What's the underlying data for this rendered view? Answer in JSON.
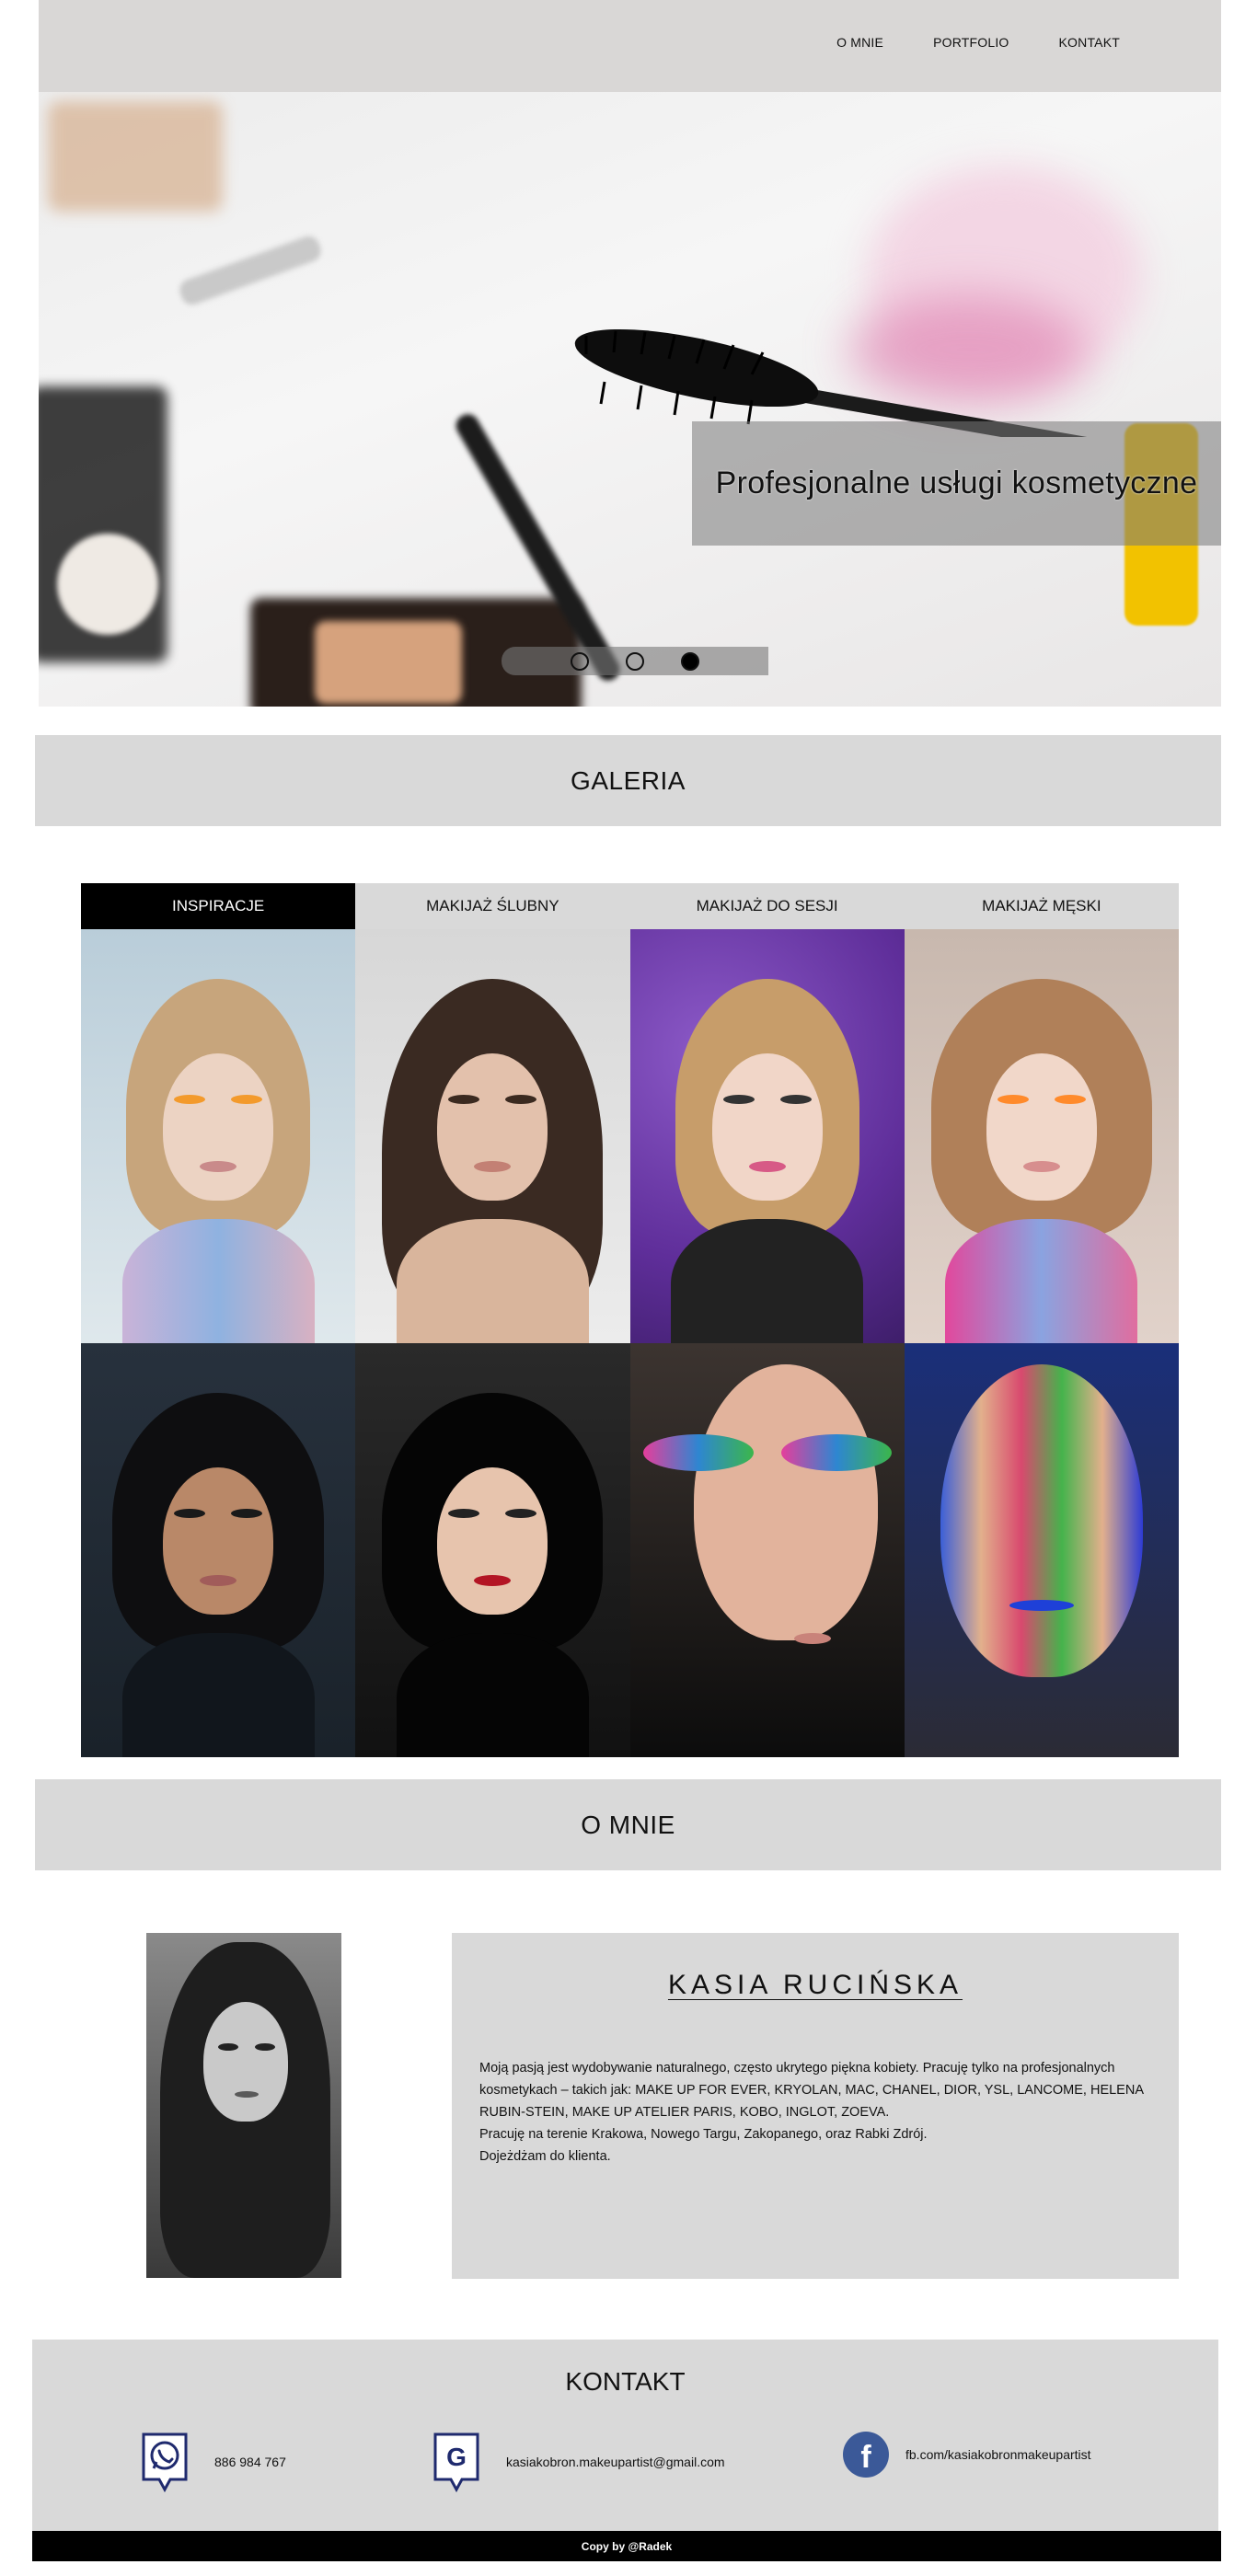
{
  "nav": {
    "links": [
      "O MNIE",
      "PORTFOLIO",
      "KONTAKT"
    ]
  },
  "hero": {
    "caption": "Profesjonalne usługi kosmetyczne",
    "slides": 3,
    "active_slide": 3
  },
  "galeria": {
    "title": "GALERIA",
    "tabs": [
      "INSPIRACJE",
      "MAKIJAŻ ŚLUBNY",
      "MAKIJAŻ DO SESJI",
      "MAKIJAŻ MĘSKI"
    ],
    "active_tab": "INSPIRACJE"
  },
  "about": {
    "title": "O MNIE",
    "name": "KASIA RUCIŃSKA",
    "text_lines": [
      "Moją pasją jest wydobywanie naturalnego, często ukrytego piękna kobiety. Pracuję tylko na profesjonalnych kosmetykach – takich jak: MAKE UP FOR EVER, KRYOLAN, MAC, CHANEL, DIOR, YSL, LANCOME, HELENA RUBIN-STEIN, MAKE UP ATELIER PARIS, KOBO, INGLOT, ZOEVA.",
      "Pracuję na terenie Krakowa, Nowego Targu, Zakopanego, oraz Rabki Zdrój.",
      "Dojeżdżam do klienta."
    ]
  },
  "contact": {
    "title": "KONTAKT",
    "phone": "886 984 767",
    "email": "kasiakobron.makeupartist@gmail.com",
    "facebook": "fb.com/kasiakobronmakeupartist"
  },
  "footer": {
    "copy": "Copy by @Radek"
  },
  "colors": {
    "nav_bg": "#d9d7d6",
    "section_bg": "#d9d9d9",
    "active_tab_bg": "#000000",
    "facebook_blue": "#3b5998",
    "pin_outline": "#1f2a6e"
  }
}
